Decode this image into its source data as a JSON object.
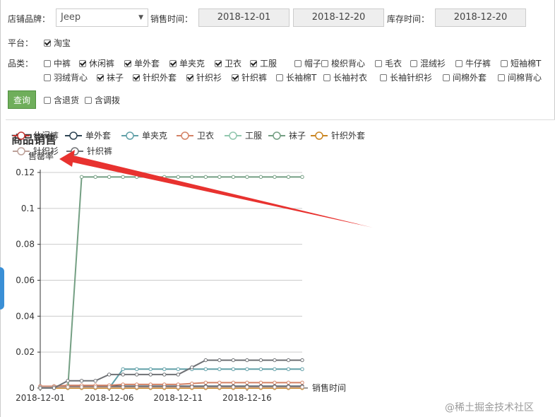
{
  "filters": {
    "brand_label": "店铺品牌：",
    "brand_value": "Jeep",
    "sales_time_label": "销售时间：",
    "sales_start": "2018-12-01",
    "sales_end": "2018-12-20",
    "stock_time_label": "库存时间：",
    "stock_date": "2018-12-20",
    "platform_label": "平台：",
    "platform": {
      "label": "淘宝",
      "checked": true
    },
    "category_label": "品类：",
    "categories_row1": [
      {
        "label": "中裤",
        "checked": false
      },
      {
        "label": "休闲裤",
        "checked": true
      },
      {
        "label": "单外套",
        "checked": true
      },
      {
        "label": "单夹克",
        "checked": true
      },
      {
        "label": "卫衣",
        "checked": true
      },
      {
        "label": "工服",
        "checked": true
      },
      {
        "label": "帽子",
        "checked": false
      },
      {
        "label": "梭织背心",
        "checked": false
      },
      {
        "label": "毛衣",
        "checked": false
      },
      {
        "label": "混绒衫",
        "checked": false
      },
      {
        "label": "牛仔裤",
        "checked": false
      },
      {
        "label": "短袖棉T",
        "checked": false
      }
    ],
    "categories_row2": [
      {
        "label": "羽绒背心",
        "checked": false
      },
      {
        "label": "袜子",
        "checked": true
      },
      {
        "label": "针织外套",
        "checked": true
      },
      {
        "label": "针织衫",
        "checked": true
      },
      {
        "label": "针织裤",
        "checked": true
      },
      {
        "label": "长袖棉T",
        "checked": false
      },
      {
        "label": "长袖衬衣",
        "checked": false
      },
      {
        "label": "长袖针织衫",
        "checked": false
      },
      {
        "label": "间棉外套",
        "checked": false
      },
      {
        "label": "间棉背心",
        "checked": false
      }
    ],
    "query_button": "查询",
    "include_returns": {
      "label": "含退货",
      "checked": false
    },
    "include_transfers": {
      "label": "含调拨",
      "checked": false
    }
  },
  "colors": {
    "query_button": "#6fae5b",
    "arrow": "#e8322f"
  },
  "watermark": "@稀土掘金技术社区",
  "chart_data": {
    "type": "line",
    "title": "商品销售",
    "ylabel": "售罄率",
    "xlabel": "销售时间",
    "ylim": [
      0,
      0.12
    ],
    "yticks": [
      "0",
      "0.02",
      "0.04",
      "0.06",
      "0.08",
      "0.1",
      "0.12"
    ],
    "x_tick_labels": [
      "2018-12-01",
      "2018-12-06",
      "2018-12-11",
      "2018-12-16"
    ],
    "x_tick_indices": [
      0,
      5,
      10,
      15
    ],
    "x": [
      "2018-12-01",
      "2018-12-02",
      "2018-12-03",
      "2018-12-04",
      "2018-12-05",
      "2018-12-06",
      "2018-12-07",
      "2018-12-08",
      "2018-12-09",
      "2018-12-10",
      "2018-12-11",
      "2018-12-12",
      "2018-12-13",
      "2018-12-14",
      "2018-12-15",
      "2018-12-16",
      "2018-12-17",
      "2018-12-18",
      "2018-12-19",
      "2018-12-20"
    ],
    "series": [
      {
        "name": "休闲裤",
        "color": "#c23531",
        "values": [
          0,
          0,
          0,
          0,
          0,
          0,
          0,
          0,
          0,
          0,
          0,
          0,
          0,
          0,
          0,
          0,
          0,
          0,
          0,
          0
        ]
      },
      {
        "name": "单外套",
        "color": "#2f4554",
        "values": [
          0.001,
          0.001,
          0.001,
          0.001,
          0.001,
          0.001,
          0.001,
          0.001,
          0.001,
          0.001,
          0.001,
          0.001,
          0.001,
          0.001,
          0.001,
          0.001,
          0.001,
          0.001,
          0.001,
          0.001
        ]
      },
      {
        "name": "单夹克",
        "color": "#61a0a8",
        "values": [
          0,
          0,
          0,
          0,
          0,
          0,
          0.0105,
          0.0105,
          0.0105,
          0.0105,
          0.0105,
          0.0105,
          0.0105,
          0.0105,
          0.0105,
          0.0105,
          0.0105,
          0.0105,
          0.0105,
          0.0105
        ]
      },
      {
        "name": "卫衣",
        "color": "#d48265",
        "values": [
          0.001,
          0.001,
          0.0015,
          0.0015,
          0.0015,
          0.0015,
          0.002,
          0.002,
          0.002,
          0.002,
          0.002,
          0.0025,
          0.003,
          0.003,
          0.003,
          0.003,
          0.003,
          0.003,
          0.003,
          0.003
        ]
      },
      {
        "name": "工服",
        "color": "#91c7ae",
        "values": [
          0,
          0,
          0,
          0,
          0,
          0,
          0,
          0,
          0,
          0,
          0,
          0,
          0,
          0,
          0,
          0,
          0,
          0,
          0,
          0
        ]
      },
      {
        "name": "袜子",
        "color": "#749f83",
        "values": [
          0,
          0,
          0,
          0.1175,
          0.1175,
          0.1175,
          0.1175,
          0.1175,
          0.1175,
          0.1175,
          0.1175,
          0.1175,
          0.1175,
          0.1175,
          0.1175,
          0.1175,
          0.1175,
          0.1175,
          0.1175,
          0.1175
        ]
      },
      {
        "name": "针织外套",
        "color": "#ca8622",
        "values": [
          0,
          0,
          0,
          0,
          0,
          0,
          0,
          0,
          0,
          0,
          0,
          0,
          0,
          0,
          0,
          0,
          0,
          0,
          0,
          0
        ]
      },
      {
        "name": "针织衫",
        "color": "#bda29a",
        "values": [
          0.0005,
          0.0005,
          0.0005,
          0.0005,
          0.0005,
          0.0005,
          0.0005,
          0.0005,
          0.0005,
          0.0005,
          0.0005,
          0.0005,
          0.0005,
          0.0005,
          0.0005,
          0.0005,
          0.0005,
          0.0005,
          0.0005,
          0.0005
        ]
      },
      {
        "name": "针织裤",
        "color": "#6e7074",
        "values": [
          0,
          0,
          0.004,
          0.004,
          0.004,
          0.0075,
          0.0075,
          0.0075,
          0.0075,
          0.0075,
          0.0075,
          0.0115,
          0.0155,
          0.0155,
          0.0155,
          0.0155,
          0.0155,
          0.0155,
          0.0155,
          0.0155
        ]
      }
    ]
  }
}
